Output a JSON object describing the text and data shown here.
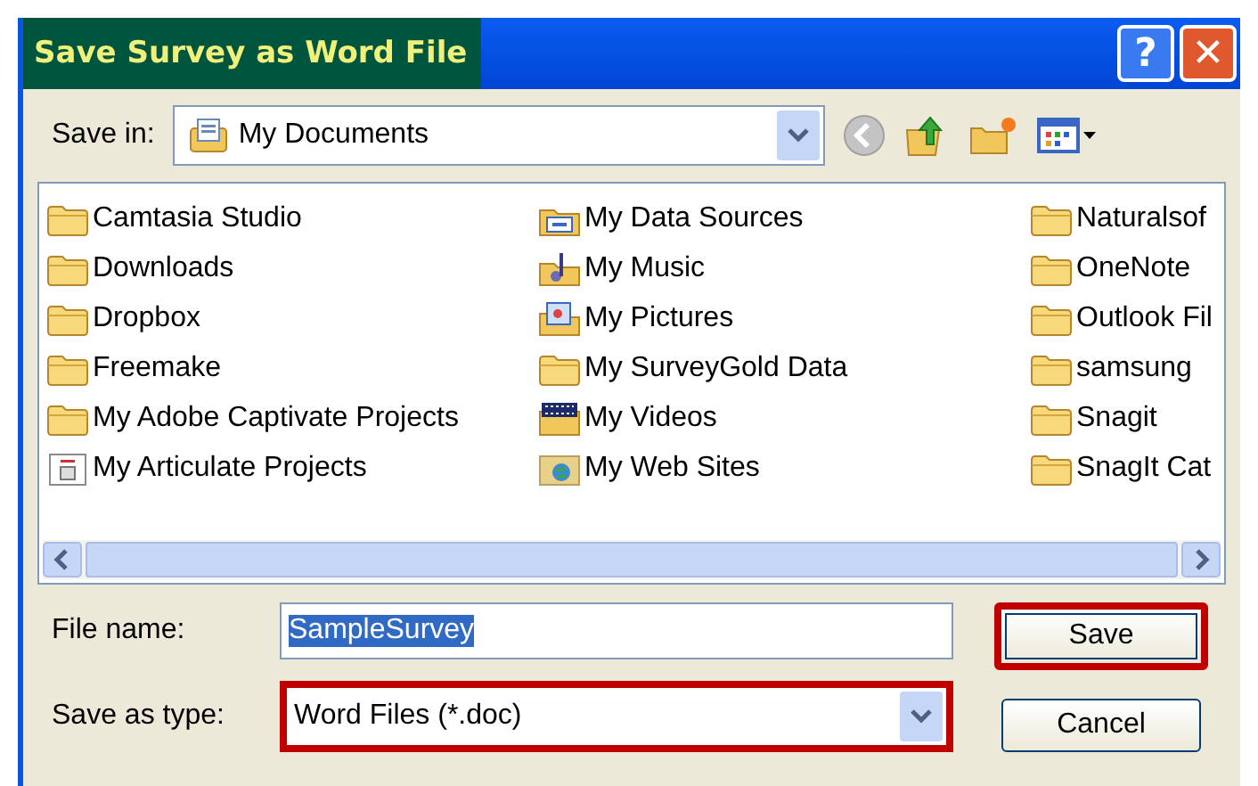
{
  "window": {
    "title": "Save Survey as Word File",
    "title_highlighted": true,
    "help_button": "?",
    "close_button": "✕"
  },
  "toolbar": {
    "save_in_label": "Save in:",
    "location": "My Documents"
  },
  "files": [
    {
      "name": "Camtasia Studio",
      "kind": "folder"
    },
    {
      "name": "Downloads",
      "kind": "folder"
    },
    {
      "name": "Dropbox",
      "kind": "folder"
    },
    {
      "name": "Freemake",
      "kind": "folder"
    },
    {
      "name": "My Adobe Captivate Projects",
      "kind": "folder"
    },
    {
      "name": "My Articulate Projects",
      "kind": "app"
    },
    {
      "name": "My Data Sources",
      "kind": "network"
    },
    {
      "name": "My Music",
      "kind": "music"
    },
    {
      "name": "My Pictures",
      "kind": "pictures"
    },
    {
      "name": "My SurveyGold Data",
      "kind": "folder"
    },
    {
      "name": "My Videos",
      "kind": "videos"
    },
    {
      "name": "My Web Sites",
      "kind": "web"
    },
    {
      "name": "Naturalsof",
      "kind": "folder"
    },
    {
      "name": "OneNote",
      "kind": "folder"
    },
    {
      "name": "Outlook Fil",
      "kind": "folder"
    },
    {
      "name": "samsung",
      "kind": "folder"
    },
    {
      "name": "Snagit",
      "kind": "folder"
    },
    {
      "name": "SnagIt Cat",
      "kind": "folder"
    }
  ],
  "file_name": {
    "label": "File name:",
    "value": "SampleSurvey",
    "text_selected": true
  },
  "save_as_type": {
    "label": "Save as type:",
    "value": "Word Files (*.doc)",
    "highlighted": true
  },
  "buttons": [
    {
      "label": "Save",
      "highlighted": true
    },
    {
      "label": "Cancel",
      "highlighted": false
    }
  ]
}
